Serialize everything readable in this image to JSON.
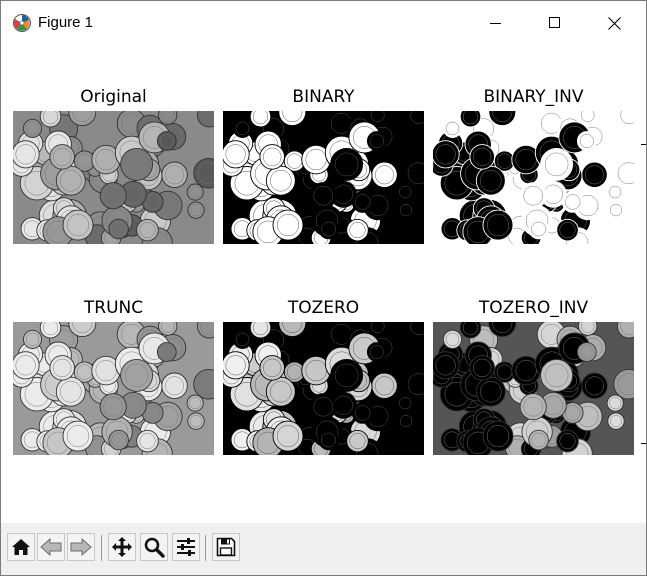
{
  "window": {
    "title": "Figure 1"
  },
  "panels": [
    {
      "title": "Original"
    },
    {
      "title": "BINARY"
    },
    {
      "title": "BINARY_INV"
    },
    {
      "title": "TRUNC"
    },
    {
      "title": "TOZERO"
    },
    {
      "title": "TOZERO_INV"
    }
  ],
  "toolbar": {
    "buttons": [
      {
        "icon": "home-icon"
      },
      {
        "icon": "back-arrow-icon"
      },
      {
        "icon": "forward-arrow-icon"
      },
      {
        "icon": "pan-move-icon"
      },
      {
        "icon": "zoom-magnifier-icon"
      },
      {
        "icon": "subplots-sliders-icon"
      },
      {
        "icon": "save-floppy-icon"
      }
    ]
  }
}
